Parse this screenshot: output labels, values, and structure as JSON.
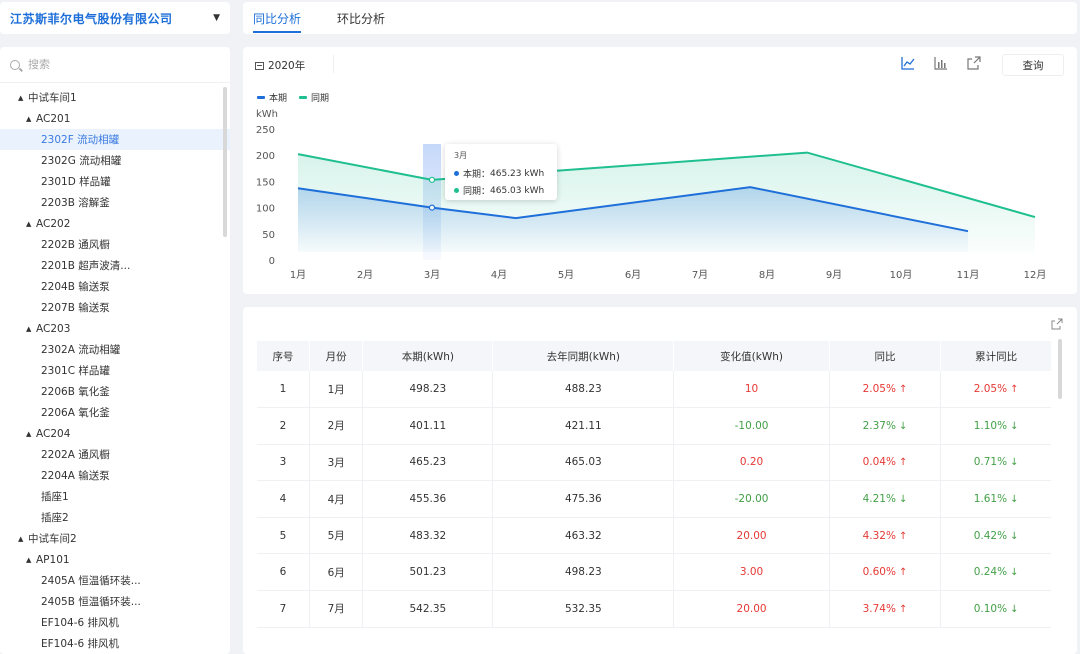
{
  "company": {
    "name": "江苏斯菲尔电气股份有限公司"
  },
  "search": {
    "placeholder": "搜索"
  },
  "tree": [
    {
      "label": "中试车间1",
      "level": "l0",
      "expanded": true
    },
    {
      "label": "AC201",
      "level": "l1",
      "expanded": true
    },
    {
      "label": "2302F 流动相罐",
      "level": "l2",
      "selected": true
    },
    {
      "label": "2302G 流动相罐",
      "level": "l2"
    },
    {
      "label": "2301D 样品罐",
      "level": "l2"
    },
    {
      "label": "2203B 溶解釜",
      "level": "l2"
    },
    {
      "label": "AC202",
      "level": "l1",
      "expanded": true
    },
    {
      "label": "2202B 通风橱",
      "level": "l2"
    },
    {
      "label": "2201B 超声波清...",
      "level": "l2"
    },
    {
      "label": "2204B 输送泵",
      "level": "l2"
    },
    {
      "label": "2207B 输送泵",
      "level": "l2"
    },
    {
      "label": "AC203",
      "level": "l1",
      "expanded": true
    },
    {
      "label": "2302A 流动相罐",
      "level": "l2"
    },
    {
      "label": "2301C 样品罐",
      "level": "l2"
    },
    {
      "label": "2206B 氧化釜",
      "level": "l2"
    },
    {
      "label": "2206A 氧化釜",
      "level": "l2"
    },
    {
      "label": "AC204",
      "level": "l1",
      "expanded": true
    },
    {
      "label": "2202A 通风橱",
      "level": "l2"
    },
    {
      "label": "2204A 输送泵",
      "level": "l2"
    },
    {
      "label": "插座1",
      "level": "l1b"
    },
    {
      "label": "插座2",
      "level": "l1b"
    },
    {
      "label": "中试车间2",
      "level": "l0",
      "expanded": true
    },
    {
      "label": "AP101",
      "level": "l1",
      "expanded": true
    },
    {
      "label": "2405A 恒温循环装...",
      "level": "l2"
    },
    {
      "label": "2405B 恒温循环装...",
      "level": "l2"
    },
    {
      "label": "EF104-6 排风机",
      "level": "l2"
    },
    {
      "label": "EF104-6 排风机",
      "level": "l2"
    }
  ],
  "tabs": [
    {
      "label": "同比分析",
      "active": true
    },
    {
      "label": "环比分析",
      "active": false
    }
  ],
  "toolbar": {
    "year": "2020年",
    "query_label": "查询",
    "icons": [
      "line-chart-icon",
      "bar-chart-icon",
      "export-icon"
    ]
  },
  "colors": {
    "current": "#1e6fd9",
    "last_year": "#1fbf8f",
    "accent": "#1e6fd9"
  },
  "chart_data": {
    "type": "line",
    "ylabel": "kWh",
    "ylim": [
      0,
      250
    ],
    "yticks": [
      0,
      50,
      100,
      150,
      200,
      250
    ],
    "categories": [
      "1月",
      "2月",
      "3月",
      "4月",
      "5月",
      "6月",
      "7月",
      "8月",
      "9月",
      "10月",
      "11月",
      "12月"
    ],
    "series": [
      {
        "name": "本期",
        "color": "#1e6fd9",
        "points": [
          [
            1,
            137
          ],
          [
            3,
            100
          ],
          [
            4.25,
            80
          ],
          [
            7.75,
            139
          ],
          [
            11,
            55
          ]
        ]
      },
      {
        "name": "同期",
        "color": "#1fbf8f",
        "points": [
          [
            1,
            202
          ],
          [
            3,
            153
          ],
          [
            8.6,
            205
          ],
          [
            12,
            82
          ]
        ]
      }
    ],
    "tooltip": {
      "title": "3月",
      "current_label": "本期：",
      "current_value": "465.23 kWh",
      "last_label": "同期：",
      "last_value": "465.03 kWh"
    },
    "highlight_category": "3月",
    "grid": false,
    "legend": "top-left"
  },
  "table": {
    "columns": [
      "序号",
      "月份",
      "本期(kWh)",
      "去年同期(kWh)",
      "变化值(kWh)",
      "同比",
      "累计同比"
    ],
    "rows": [
      {
        "idx": "1",
        "month": "1月",
        "current": "498.23",
        "last": "488.23",
        "change": "10",
        "change_sign": "pos",
        "yoy": "2.05%",
        "yoy_dir": "up",
        "cum": "2.05%",
        "cum_dir": "up"
      },
      {
        "idx": "2",
        "month": "2月",
        "current": "401.11",
        "last": "421.11",
        "change": "-10.00",
        "change_sign": "neg",
        "yoy": "2.37%",
        "yoy_dir": "down",
        "cum": "1.10%",
        "cum_dir": "down"
      },
      {
        "idx": "3",
        "month": "3月",
        "current": "465.23",
        "last": "465.03",
        "change": "0.20",
        "change_sign": "pos",
        "yoy": "0.04%",
        "yoy_dir": "up",
        "cum": "0.71%",
        "cum_dir": "down"
      },
      {
        "idx": "4",
        "month": "4月",
        "current": "455.36",
        "last": "475.36",
        "change": "-20.00",
        "change_sign": "neg",
        "yoy": "4.21%",
        "yoy_dir": "down",
        "cum": "1.61%",
        "cum_dir": "down"
      },
      {
        "idx": "5",
        "month": "5月",
        "current": "483.32",
        "last": "463.32",
        "change": "20.00",
        "change_sign": "pos",
        "yoy": "4.32%",
        "yoy_dir": "up",
        "cum": "0.42%",
        "cum_dir": "down"
      },
      {
        "idx": "6",
        "month": "6月",
        "current": "501.23",
        "last": "498.23",
        "change": "3.00",
        "change_sign": "pos",
        "yoy": "0.60%",
        "yoy_dir": "up",
        "cum": "0.24%",
        "cum_dir": "down"
      },
      {
        "idx": "7",
        "month": "7月",
        "current": "542.35",
        "last": "532.35",
        "change": "20.00",
        "change_sign": "pos",
        "yoy": "3.74%",
        "yoy_dir": "up",
        "cum": "0.10%",
        "cum_dir": "down"
      }
    ]
  }
}
